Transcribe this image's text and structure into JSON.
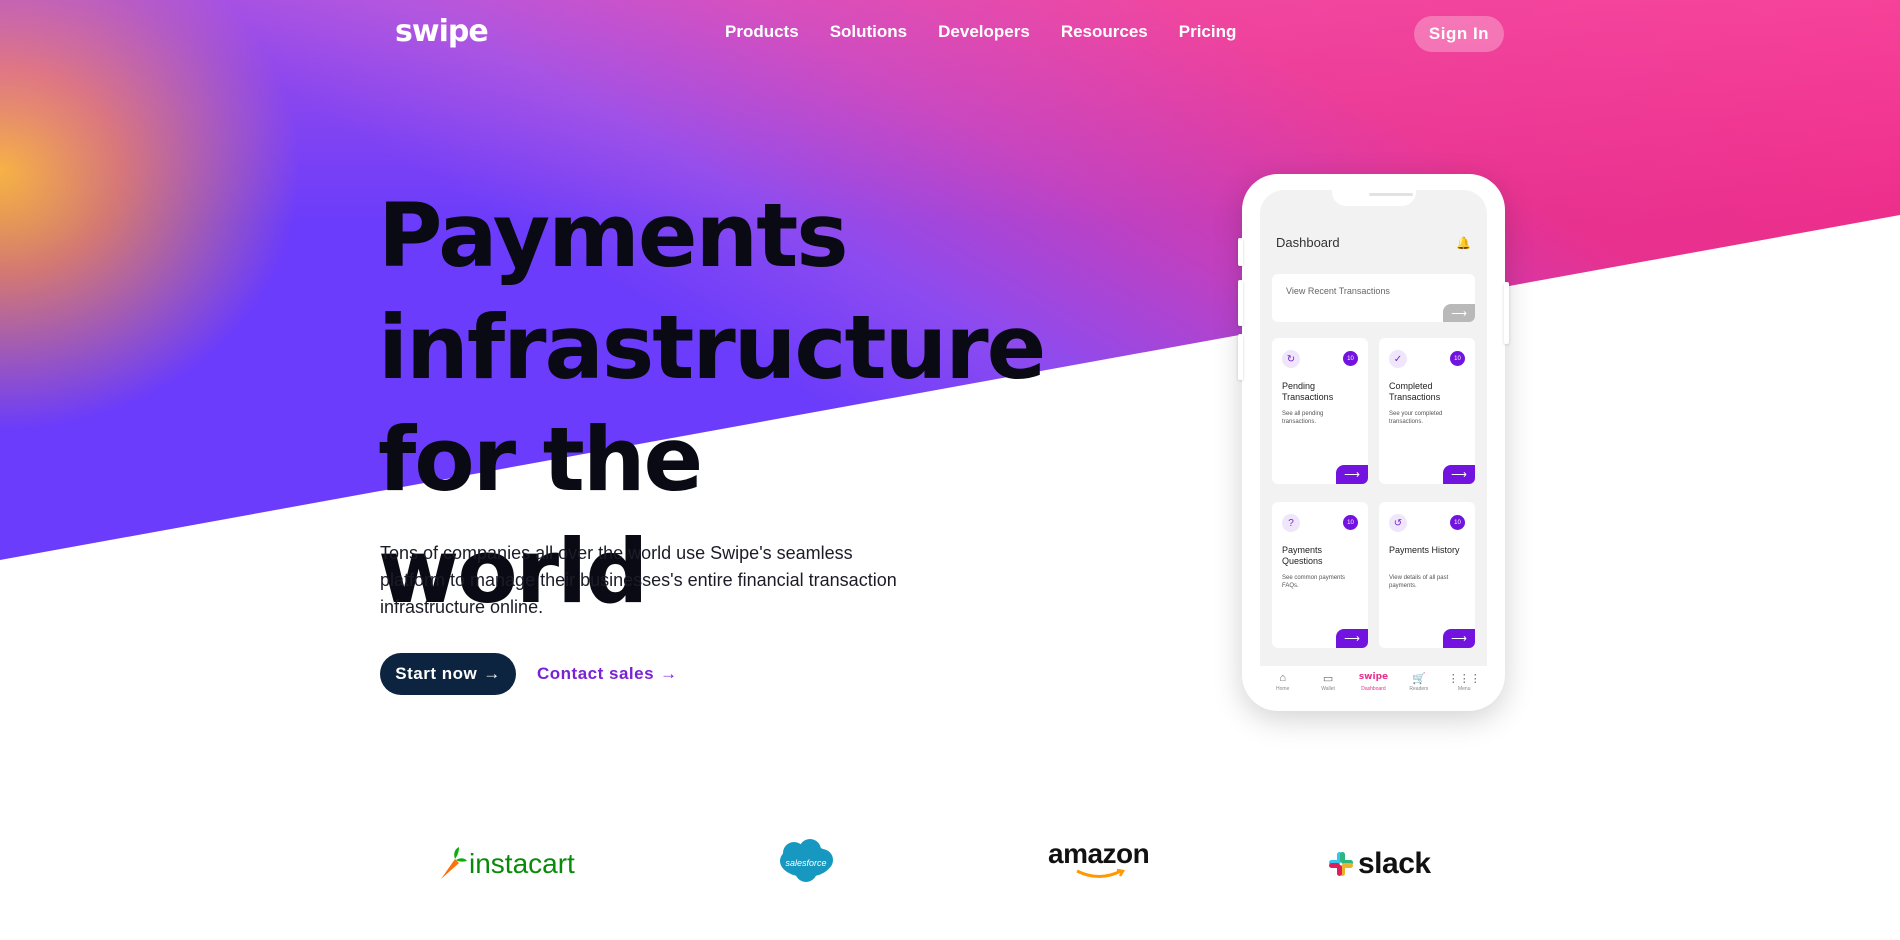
{
  "brand": {
    "logo_text": "swipe"
  },
  "nav": {
    "items": [
      "Products",
      "Solutions",
      "Developers",
      "Resources",
      "Pricing"
    ],
    "sign_in": "Sign In"
  },
  "hero": {
    "headline": [
      "Payments",
      "infrastructure",
      "for the world"
    ],
    "subtext": "Tons of companies all over the world use Swipe's seamless platform to manage their businesses's entire financial transaction infrastructure online.",
    "cta_primary": "Start now",
    "cta_secondary": "Contact sales"
  },
  "phone": {
    "title": "Dashboard",
    "recent": "View Recent Transactions",
    "cards": [
      {
        "title": "Pending Transactions",
        "desc": "See all pending transactions.",
        "badge": "10",
        "icon": "refresh-icon"
      },
      {
        "title": "Completed Transactions",
        "desc": "See your completed transactions.",
        "badge": "10",
        "icon": "check-icon"
      },
      {
        "title": "Payments Questions",
        "desc": "See common payments FAQs.",
        "badge": "10",
        "icon": "question-icon"
      },
      {
        "title": "Payments History",
        "desc": "View details of all past payments.",
        "badge": "10",
        "icon": "history-icon"
      }
    ],
    "tabs": [
      {
        "label": "Home",
        "icon": "home-icon"
      },
      {
        "label": "Wallet",
        "icon": "wallet-icon"
      },
      {
        "label": "Dashboard",
        "icon": "swipe-logo"
      },
      {
        "label": "Readers",
        "icon": "cart-icon"
      },
      {
        "label": "Menu",
        "icon": "grid-icon"
      }
    ]
  },
  "customers": {
    "logos": [
      "instacart",
      "salesforce",
      "amazon",
      "slack"
    ]
  },
  "colors": {
    "accent": "#7313e0",
    "cta_bg": "#0c2440",
    "gradient_purple": "#6b3cfb",
    "gradient_pink": "#f22a86",
    "gradient_orange": "#f6b83a",
    "instacart_green": "#0aad0a",
    "salesforce_blue": "#1798c1"
  }
}
